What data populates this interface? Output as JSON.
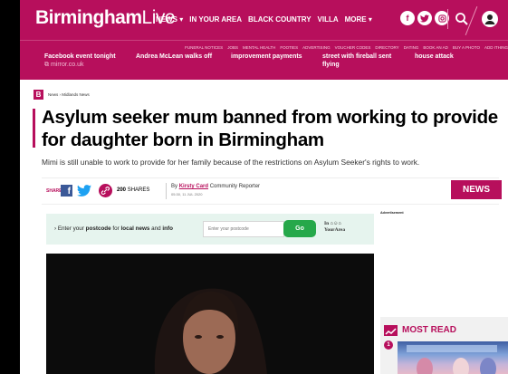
{
  "brand": {
    "name_bold": "Birmingham",
    "name_light": "Live",
    "color": "#b70f5c"
  },
  "nav": {
    "links": [
      "NEWS ▾",
      "IN YOUR AREA",
      "BLACK COUNTRY",
      "VILLA",
      "MORE ▾"
    ],
    "social_icons": [
      "facebook-icon",
      "twitter-icon",
      "instagram-icon"
    ]
  },
  "subnav": {
    "links": [
      "FUNERAL NOTICES",
      "JOBS",
      "MENTAL HEALTH",
      "FOOTIES",
      "ADVERTISING",
      "VOUCHER CODES",
      "DIRECTORY",
      "DATING",
      "BOOK AN AD",
      "BUY A PHOTO",
      "ADD ITHING"
    ]
  },
  "ticker": [
    {
      "title": "Facebook event tonight",
      "source": "mirror.co.uk"
    },
    {
      "title": "Andrea McLean walks off",
      "source": ""
    },
    {
      "title": "improvement payments",
      "source": ""
    },
    {
      "title": "street with fireball sent flying",
      "source": ""
    },
    {
      "title": "house attack",
      "source": ""
    }
  ],
  "breadcrumb": {
    "logo": "B",
    "text": "News › Midlands News"
  },
  "article": {
    "headline": "Asylum seeker mum banned from working to provide for daughter born in Birmingham",
    "standfirst": "Mimi is still unable to work to provide for her family because of the restrictions on Asylum Seeker's rights to work.",
    "share_label": "SHARE",
    "share_count": "200",
    "share_count_label": "SHARES",
    "by_prefix": "By",
    "author": "Kirsty Card",
    "author_role": "Community Reporter",
    "date": "05:30, 11 JUL 2020",
    "section_button": "NEWS"
  },
  "postcode": {
    "arrow": "›",
    "prefix": "Enter your",
    "bold1": "postcode",
    "middle": "for",
    "bold2": "local news",
    "suffix": "and",
    "bold3": "info",
    "placeholder": "Enter your postcode",
    "button": "Go",
    "logo_line1": "In ⌂☺⌂",
    "logo_line2": "YourArea"
  },
  "sidebar": {
    "ad_label": "Advertisement",
    "most_read_title": "MOST READ",
    "first_rank": "1"
  }
}
